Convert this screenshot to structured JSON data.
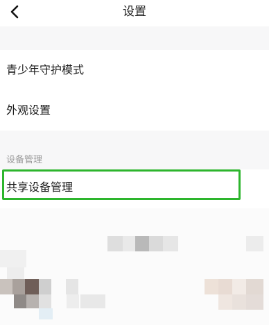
{
  "header": {
    "title": "设置",
    "back_icon": "chevron-left-icon"
  },
  "settings": {
    "items": [
      {
        "label": "青少年守护模式"
      },
      {
        "label": "外观设置"
      }
    ],
    "section": {
      "label": "设备管理",
      "items": [
        {
          "label": "共享设备管理"
        }
      ]
    }
  },
  "colors": {
    "highlight": "#2db52d",
    "section_text": "#9a9a9a"
  }
}
